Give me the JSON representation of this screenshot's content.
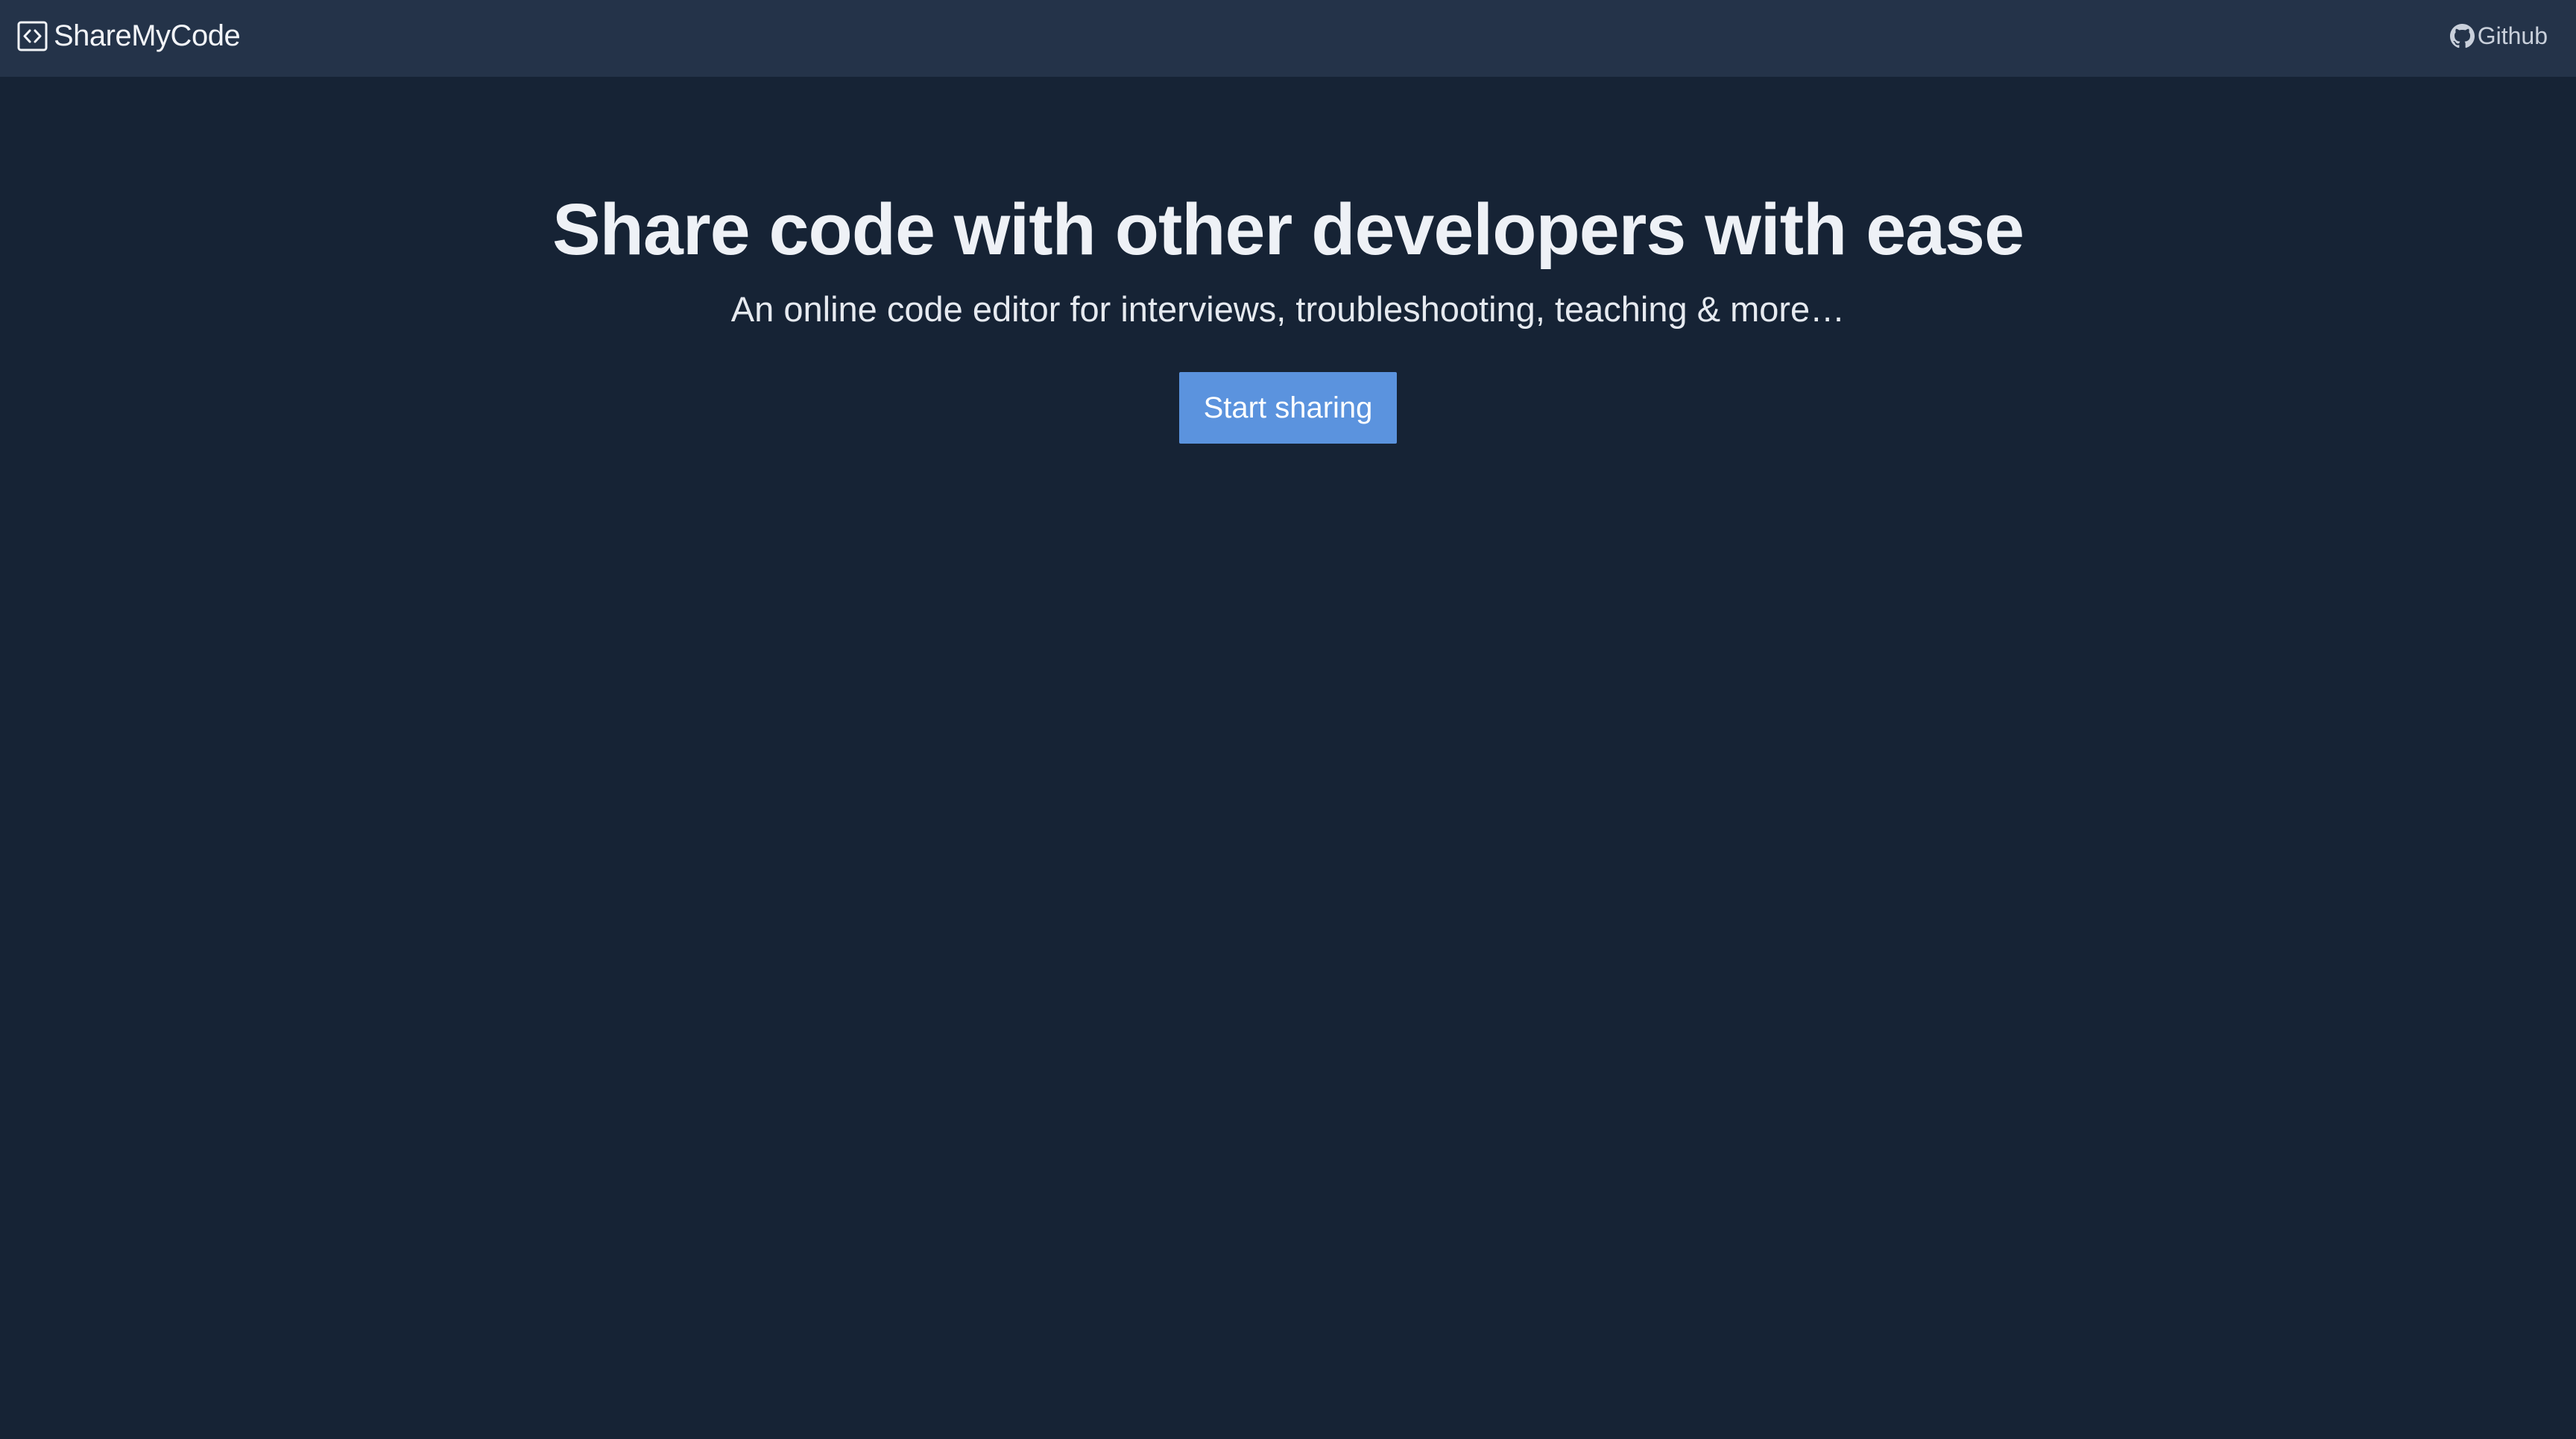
{
  "navbar": {
    "brand_icon": "code-box-icon",
    "brand_name": "ShareMyCode",
    "github_icon": "github-icon",
    "github_label": "Github"
  },
  "hero": {
    "title": "Share code with other developers with ease",
    "subtitle": "An online code editor for interviews, troubleshooting, teaching & more…",
    "cta_label": "Start sharing"
  },
  "colors": {
    "background": "#162335",
    "navbar": "#243349",
    "button": "#5b93de",
    "text": "#eef1f6"
  }
}
